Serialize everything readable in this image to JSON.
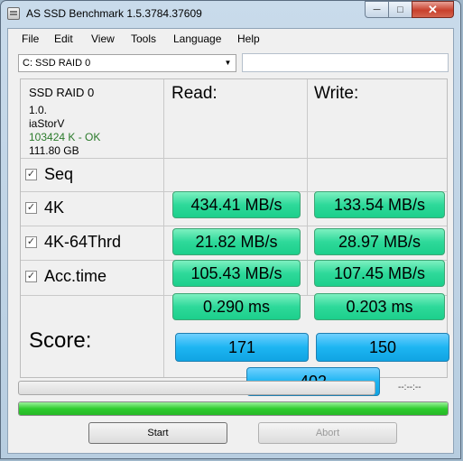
{
  "window": {
    "title": "AS SSD Benchmark 1.5.3784.37609"
  },
  "menu": [
    "File",
    "Edit",
    "View",
    "Tools",
    "Language",
    "Help"
  ],
  "drive_select": {
    "value": "C: SSD RAID 0"
  },
  "drive_info": {
    "name": "SSD RAID 0",
    "firmware": "1.0.",
    "driver": "iaStorV",
    "alignment": "103424 K - OK",
    "size": "111.80 GB"
  },
  "columns": {
    "read": "Read:",
    "write": "Write:"
  },
  "tests": [
    {
      "label": "Seq",
      "checked": true,
      "read": "434.41 MB/s",
      "write": "133.54 MB/s"
    },
    {
      "label": "4K",
      "checked": true,
      "read": "21.82 MB/s",
      "write": "28.97 MB/s"
    },
    {
      "label": "4K-64Thrd",
      "checked": true,
      "read": "105.43 MB/s",
      "write": "107.45 MB/s"
    },
    {
      "label": "Acc.time",
      "checked": true,
      "read": "0.290 ms",
      "write": "0.203 ms"
    }
  ],
  "score": {
    "label": "Score:",
    "read": "171",
    "write": "150",
    "total": "402"
  },
  "progress": {
    "time": "--:--:--",
    "overall_fill": 1.0
  },
  "buttons": {
    "start": "Start",
    "abort": "Abort"
  },
  "colors": {
    "result_bg": "#2ed99a",
    "score_bg": "#1db5f2",
    "progress": "#2ecc2e",
    "ok_text": "#2a7a2a"
  }
}
